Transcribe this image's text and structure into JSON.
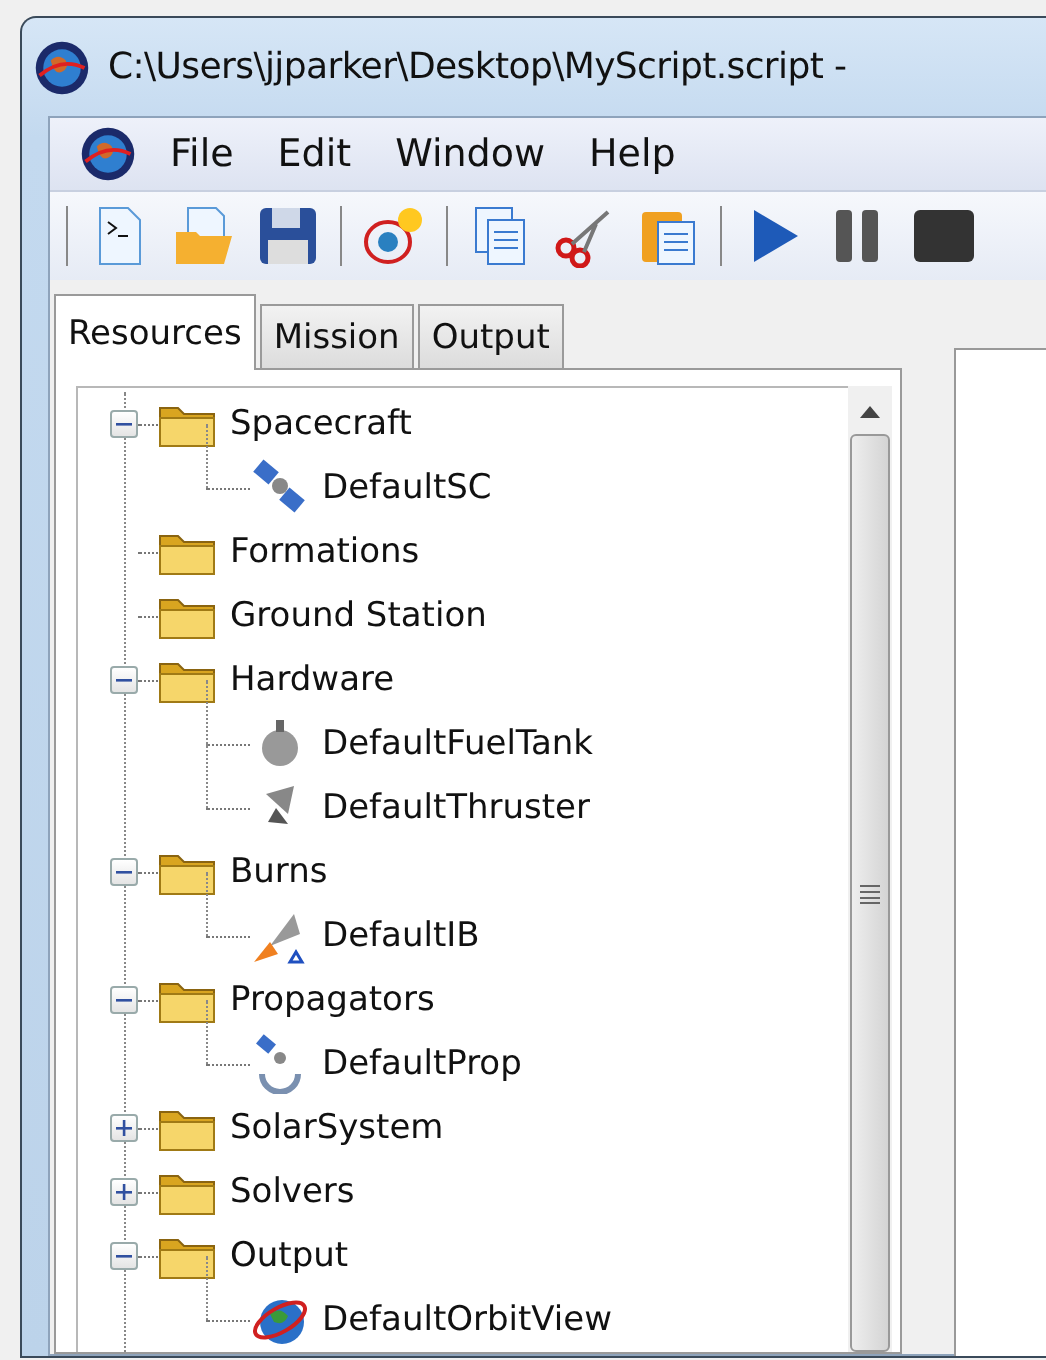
{
  "window": {
    "title": "C:\\Users\\jjparker\\Desktop\\MyScript.script -"
  },
  "menu": [
    "File",
    "Edit",
    "Window",
    "Help"
  ],
  "tabs": [
    {
      "label": "Resources",
      "selected": true
    },
    {
      "label": "Mission",
      "selected": false
    },
    {
      "label": "Output",
      "selected": false
    }
  ],
  "tree": [
    {
      "label": "Spacecraft",
      "kind": "folder",
      "expanded": true,
      "children": [
        {
          "label": "DefaultSC",
          "kind": "satellite"
        }
      ]
    },
    {
      "label": "Formations",
      "kind": "folder"
    },
    {
      "label": "Ground Station",
      "kind": "folder"
    },
    {
      "label": "Hardware",
      "kind": "folder",
      "expanded": true,
      "children": [
        {
          "label": "DefaultFuelTank",
          "kind": "tank"
        },
        {
          "label": "DefaultThruster",
          "kind": "thruster"
        }
      ]
    },
    {
      "label": "Burns",
      "kind": "folder",
      "expanded": true,
      "children": [
        {
          "label": "DefaultIB",
          "kind": "burn"
        }
      ]
    },
    {
      "label": "Propagators",
      "kind": "folder",
      "expanded": true,
      "children": [
        {
          "label": "DefaultProp",
          "kind": "propagator"
        }
      ]
    },
    {
      "label": "SolarSystem",
      "kind": "folder",
      "expanded": false
    },
    {
      "label": "Solvers",
      "kind": "folder",
      "expanded": false
    },
    {
      "label": "Output",
      "kind": "folder",
      "expanded": true,
      "children": [
        {
          "label": "DefaultOrbitView",
          "kind": "orbitview"
        }
      ]
    }
  ]
}
